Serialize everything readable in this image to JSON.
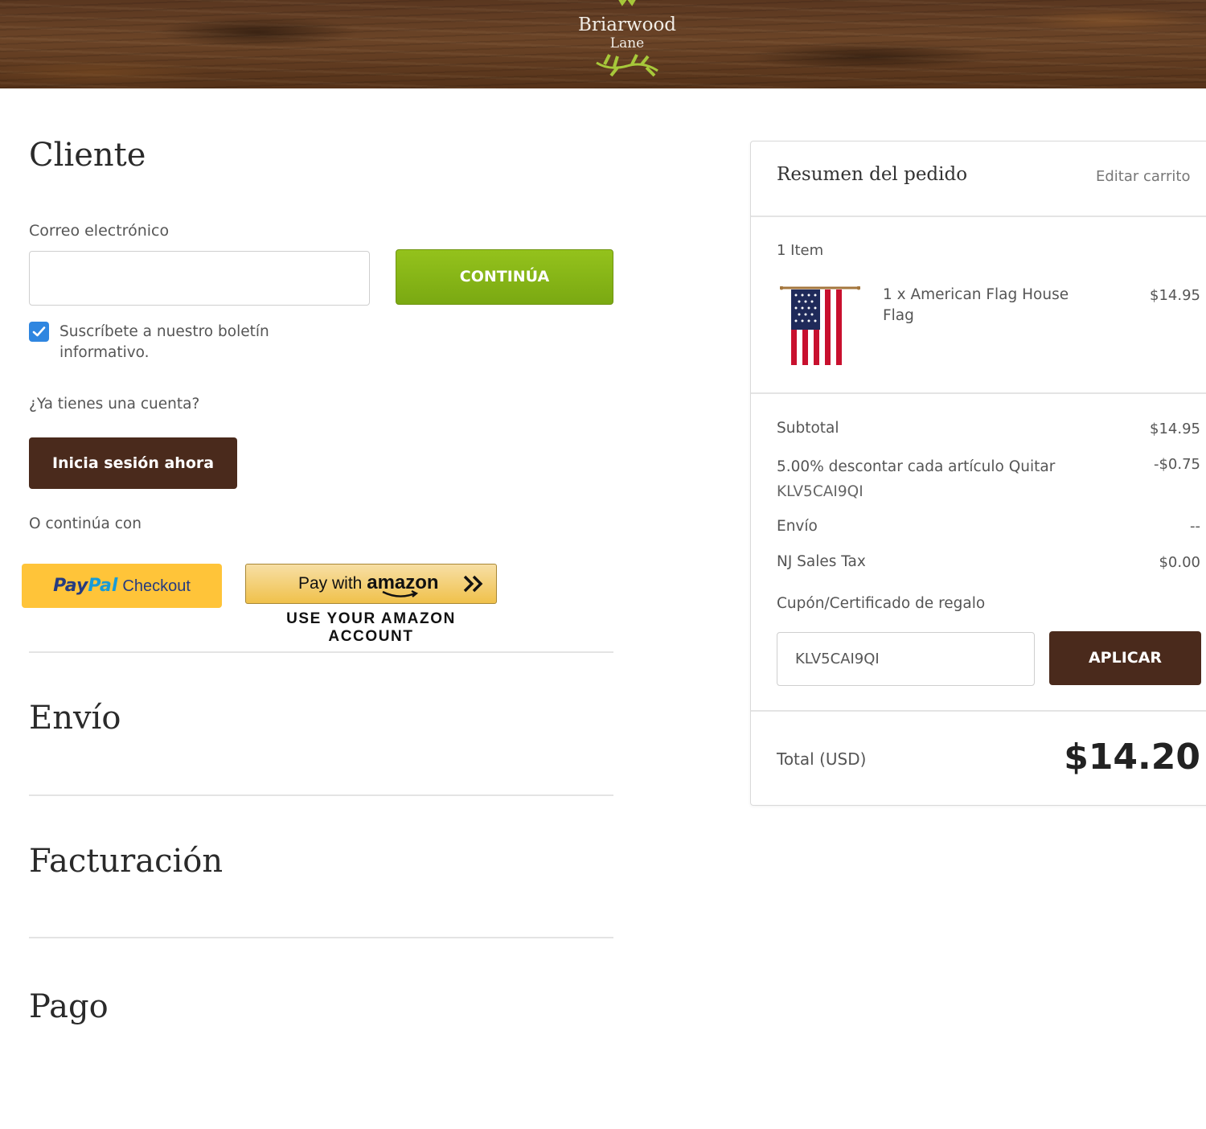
{
  "header": {
    "brand_name": "Briarwood",
    "brand_sub": "Lane"
  },
  "customer": {
    "title": "Cliente",
    "email_label": "Correo electrónico",
    "email_value": "",
    "continue_label": "CONTINÚA",
    "newsletter_checked": true,
    "newsletter_label": "Suscríbete a nuestro boletín informativo.",
    "have_account": "¿Ya tienes una cuenta?",
    "login_label": "Inicia sesión ahora",
    "or_continue": "O continúa con",
    "paypal_pay": "Pay",
    "paypal_pal": "Pal",
    "paypal_checkout": "Checkout",
    "amazon_pay_with": "Pay with",
    "amazon_brand": "amazon",
    "amazon_caption": "USE YOUR AMAZON ACCOUNT"
  },
  "sections": {
    "shipping": "Envío",
    "billing": "Facturación",
    "payment": "Pago"
  },
  "summary": {
    "title": "Resumen del pedido",
    "edit_cart": "Editar carrito",
    "item_count": "1 Item",
    "item": {
      "name": "1 x American Flag House Flag",
      "price": "$14.95",
      "image_icon": "american-flag-icon"
    },
    "subtotal_label": "Subtotal",
    "subtotal_value": "$14.95",
    "discount_label": "5.00% descontar cada artículo Quitar",
    "discount_code": "KLV5CAI9QI",
    "discount_value": "-$0.75",
    "shipping_label": "Envío",
    "shipping_value": "--",
    "tax_label": "NJ Sales Tax",
    "tax_value": "$0.00",
    "coupon_label": "Cupón/Certificado de regalo",
    "coupon_value": "KLV5CAI9QI",
    "apply_label": "APLICAR",
    "total_label": "Total (USD)",
    "total_value": "$14.20"
  },
  "colors": {
    "continue_green": "#86b516",
    "dark_brown": "#4a2a1c",
    "paypal_yellow": "#ffc439",
    "checkbox_blue": "#2f86e0"
  }
}
